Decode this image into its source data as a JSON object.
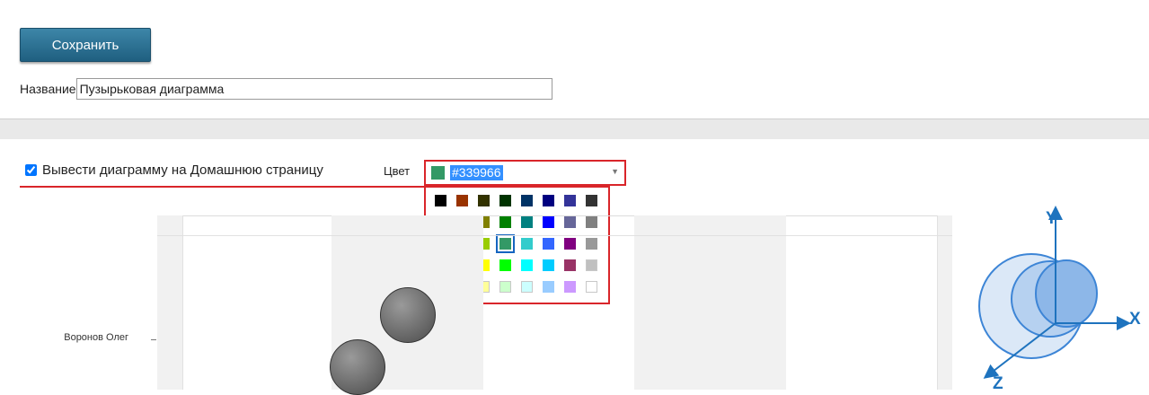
{
  "toolbar": {
    "save_label": "Сохранить"
  },
  "form": {
    "name_label": "Название",
    "name_value": "Пузырьковая диаграмма"
  },
  "options": {
    "show_on_home_label": "Вывести диаграмму на Домашнюю страницу",
    "show_on_home_checked": true,
    "color_label": "Цвет",
    "color_value": "#339966"
  },
  "palette": {
    "rows": [
      [
        "#000000",
        "#993300",
        "#333300",
        "#003300",
        "#003366",
        "#000080",
        "#333399",
        "#333333"
      ],
      [
        "#800000",
        "#ff6600",
        "#808000",
        "#008000",
        "#008080",
        "#0000ff",
        "#666699",
        "#808080"
      ],
      [
        "#ff0000",
        "#ff9900",
        "#99cc00",
        "#339966",
        "#33cccc",
        "#3366ff",
        "#800080",
        "#999999"
      ],
      [
        "#ff00ff",
        "#ffcc00",
        "#ffff00",
        "#00ff00",
        "#00ffff",
        "#00ccff",
        "#993366",
        "#c0c0c0"
      ],
      [
        "#ff99cc",
        "#ffcc99",
        "#ffff99",
        "#ccffcc",
        "#ccffff",
        "#99ccff",
        "#cc99ff",
        "#ffffff"
      ]
    ],
    "selected": "#339966"
  },
  "chart": {
    "y_category": "Воронов Олег"
  },
  "axes_icon": {
    "x_label": "X",
    "y_label": "Y",
    "z_label": "Z",
    "color": "#1e73be"
  }
}
